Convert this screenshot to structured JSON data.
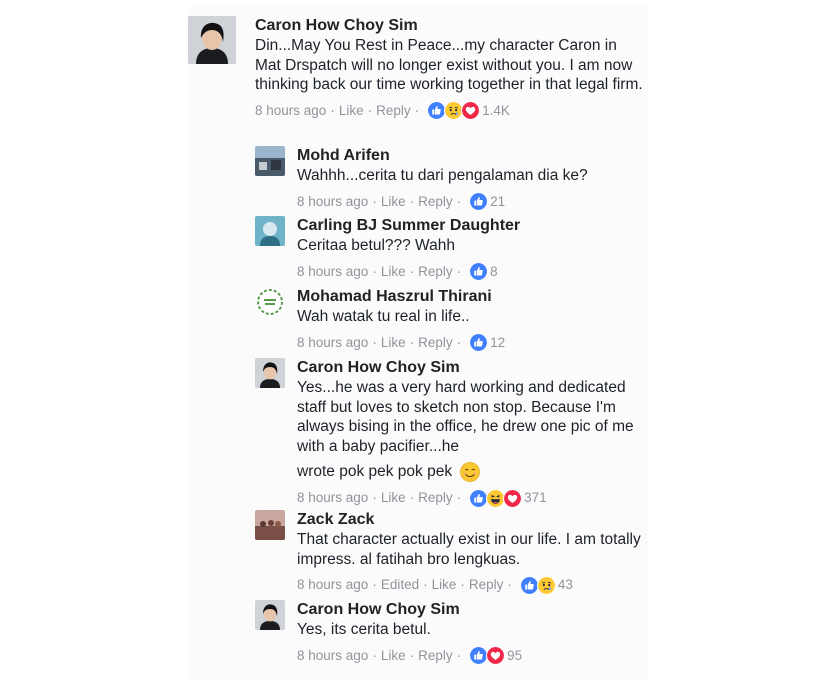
{
  "comments": [
    {
      "author": "Caron How Choy Sim",
      "text": "Din...May You Rest in Peace...my character Caron in Mat Drspatch will no longer exist without you.  I am now thinking back our time working together in that legal firm.",
      "time": "8 hours ago",
      "like": "Like",
      "reply": "Reply",
      "reactions": [
        "like-icon",
        "sad-icon",
        "love-icon"
      ],
      "count": "1.4K"
    },
    {
      "author": "Mohd Arifen",
      "text": "Wahhh...cerita tu dari pengalaman dia ke?",
      "time": "8 hours ago",
      "like": "Like",
      "reply": "Reply",
      "reactions": [
        "like-icon"
      ],
      "count": "21"
    },
    {
      "author": "Carling BJ Summer Daughter",
      "text": "Ceritaa betul??? Wahh",
      "time": "8 hours ago",
      "like": "Like",
      "reply": "Reply",
      "reactions": [
        "like-icon"
      ],
      "count": "8"
    },
    {
      "author": "Mohamad Haszrul Thirani",
      "text": "Wah watak tu real in life..",
      "time": "8 hours ago",
      "like": "Like",
      "reply": "Reply",
      "reactions": [
        "like-icon"
      ],
      "count": "12"
    },
    {
      "author": "Caron How Choy Sim",
      "text": "Yes...he was a very hard working and dedicated staff but loves to sketch non stop. Because I'm always bising in the office, he drew one pic of me with a baby pacifier...he",
      "text2": "wrote pok pek pok pek",
      "time": "8 hours ago",
      "like": "Like",
      "reply": "Reply",
      "reactions": [
        "like-icon",
        "haha-icon",
        "love-icon"
      ],
      "count": "371"
    },
    {
      "author": "Zack Zack",
      "text": "That character actually exist in our life. I am totally impress. al fatihah bro lengkuas.",
      "time": "8 hours ago",
      "edited": "Edited",
      "like": "Like",
      "reply": "Reply",
      "reactions": [
        "like-icon",
        "sad-icon"
      ],
      "count": "43"
    },
    {
      "author": "Caron How Choy Sim",
      "text": "Yes, its cerita betul.",
      "time": "8 hours ago",
      "like": "Like",
      "reply": "Reply",
      "reactions": [
        "like-icon",
        "love-icon"
      ],
      "count": "95"
    }
  ],
  "colors": {
    "like": "#4080ff",
    "love": "#f0284a",
    "reaction_yellow": "#fcc933",
    "meta": "#90949c"
  }
}
